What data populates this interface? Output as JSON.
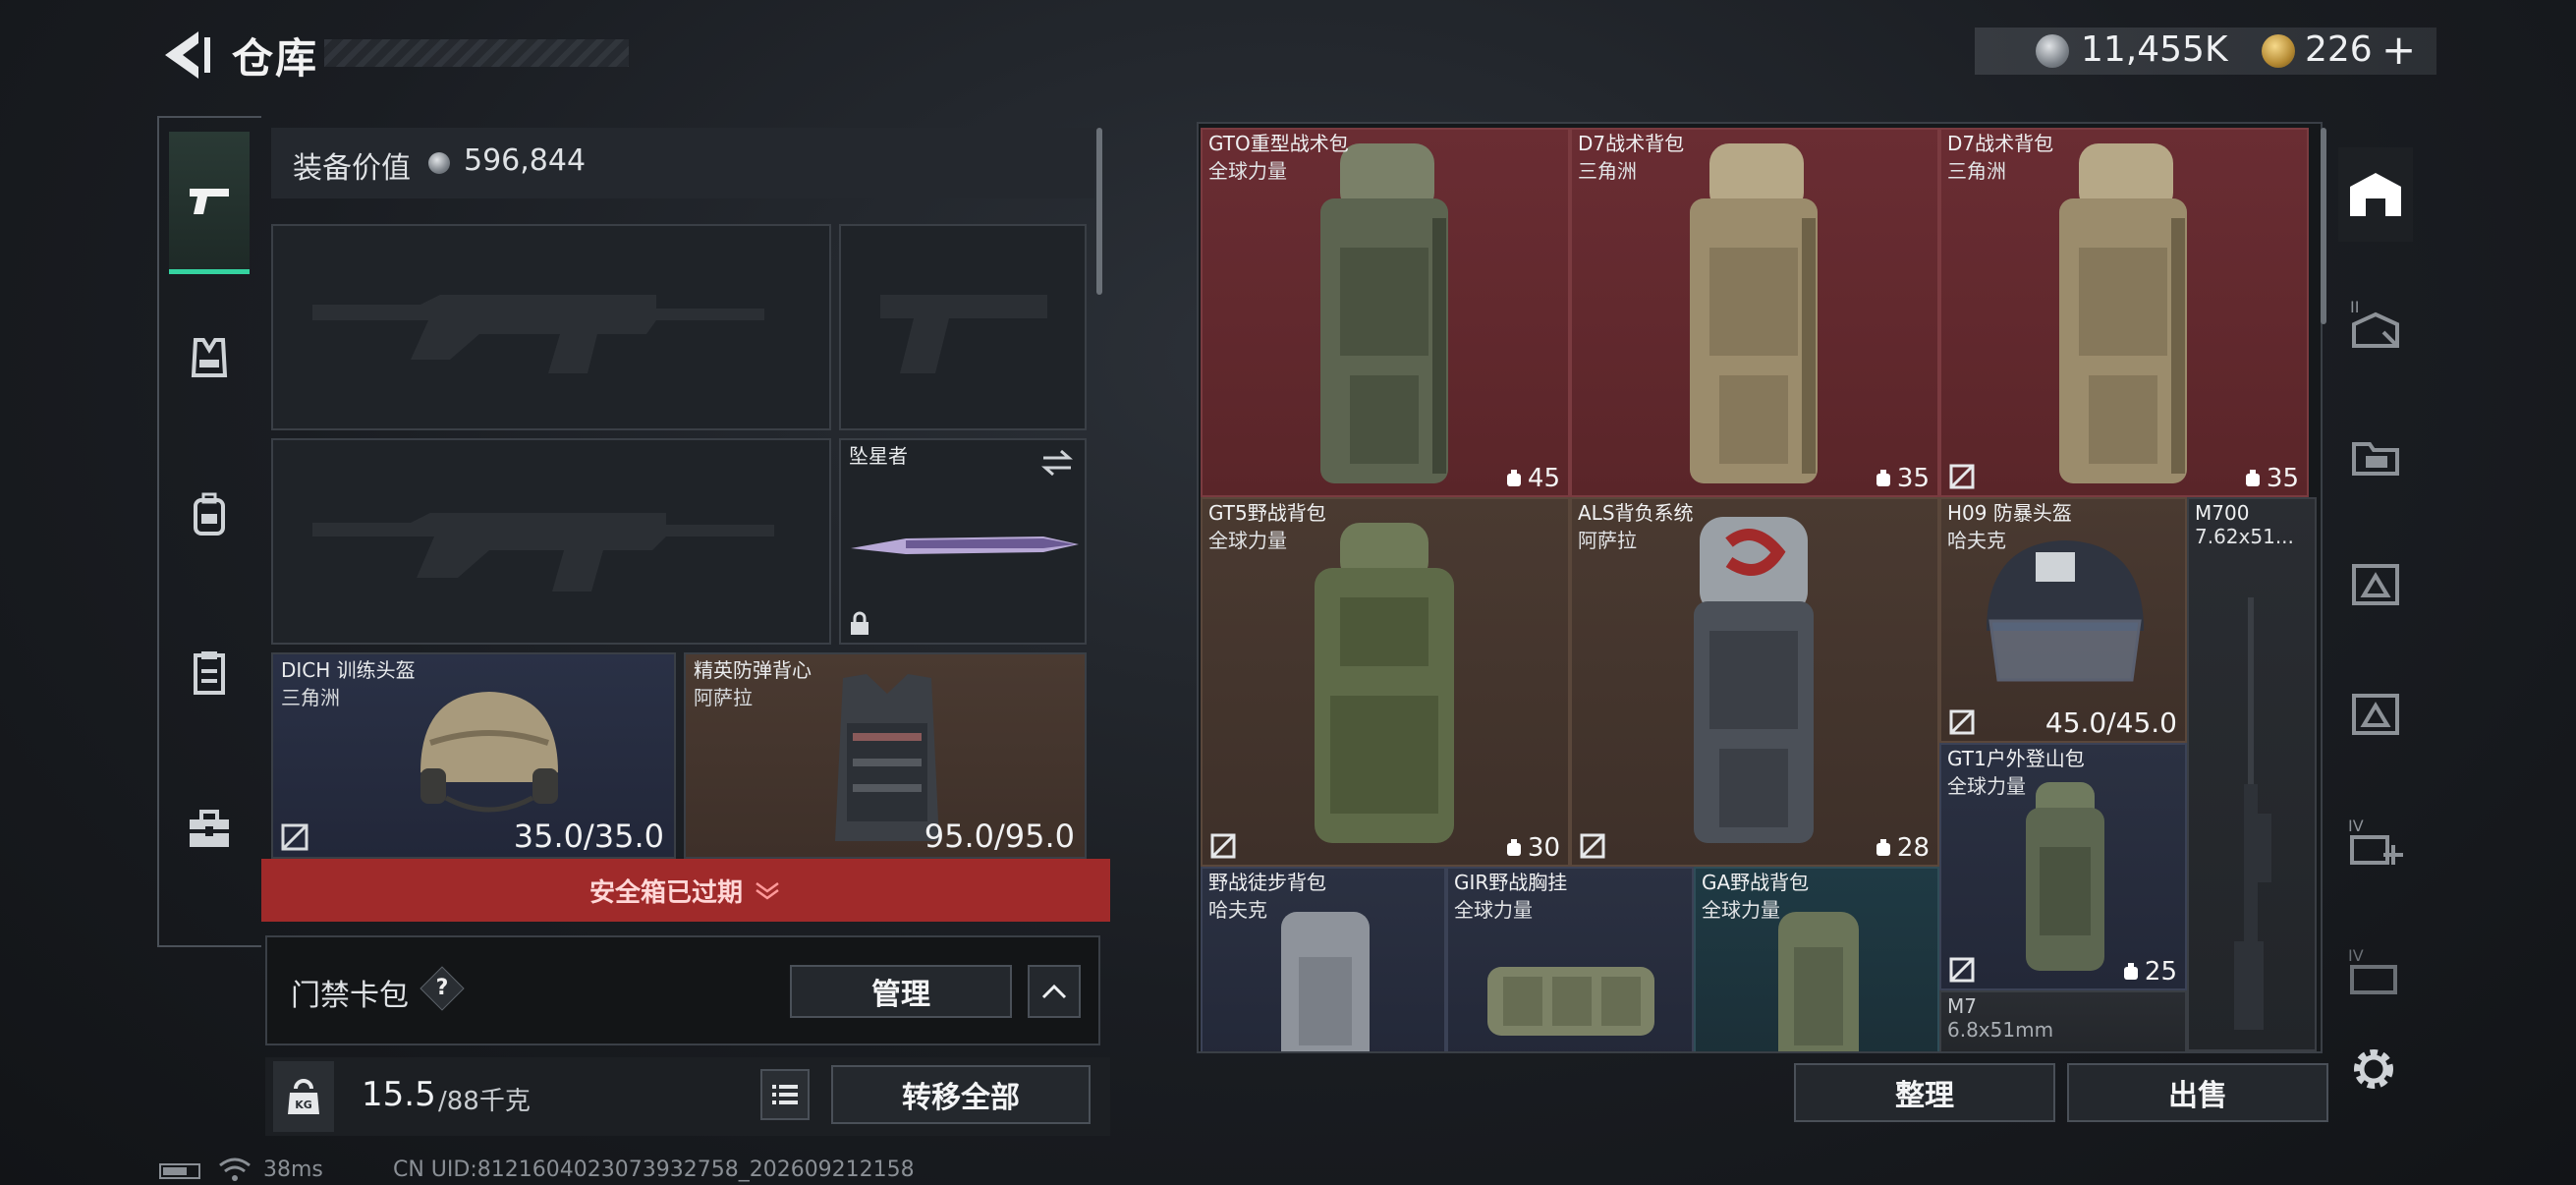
{
  "header": {
    "title": "仓库"
  },
  "currency": {
    "coins": "11,455K",
    "tokens": "226"
  },
  "loadout": {
    "value_label": "装备价值",
    "value": "596,844",
    "melee_name": "坠星者",
    "helmet": {
      "name": "DICH 训练头盔",
      "brand": "三角洲",
      "durability": "35.0/35.0"
    },
    "armor": {
      "name": "精英防弹背心",
      "brand": "阿萨拉",
      "durability": "95.0/95.0"
    },
    "safebox_status": "安全箱已过期",
    "access_label": "门禁卡包",
    "access_help": "?",
    "manage_label": "管理",
    "weight_value": "15.5",
    "weight_max": "/88千克",
    "transfer_label": "转移全部",
    "kg_icon_text": "KG"
  },
  "inventory": {
    "items": [
      {
        "name": "GTO重型战术包",
        "brand": "全球力量",
        "cap": "45"
      },
      {
        "name": "D7战术背包",
        "brand": "三角洲",
        "cap": "35"
      },
      {
        "name": "D7战术背包",
        "brand": "三角洲",
        "cap": "35"
      },
      {
        "name": "GT5野战背包",
        "brand": "全球力量",
        "cap": "30"
      },
      {
        "name": "ALS背负系统",
        "brand": "阿萨拉",
        "cap": "28"
      },
      {
        "name": "H09 防暴头盔",
        "brand": "哈夫克",
        "cap": "45.0/45.0"
      },
      {
        "name": "M700",
        "brand": "7.62x51...",
        "cap": ""
      },
      {
        "name": "GT1户外登山包",
        "brand": "全球力量",
        "cap": "25"
      },
      {
        "name": "野战徒步背包",
        "brand": "哈夫克",
        "cap": ""
      },
      {
        "name": "GIR野战胸挂",
        "brand": "全球力量",
        "cap": ""
      },
      {
        "name": "GA野战背包",
        "brand": "全球力量",
        "cap": ""
      },
      {
        "name": "M7",
        "brand": "6.8x51mm",
        "cap": ""
      }
    ],
    "sort_label": "整理",
    "sell_label": "出售"
  },
  "status": {
    "ping": "38ms",
    "uid": "CN UID:8121604023073932758_202609212158"
  },
  "colors": {
    "accent": "#35d3a0",
    "alert": "#a02a2a"
  }
}
